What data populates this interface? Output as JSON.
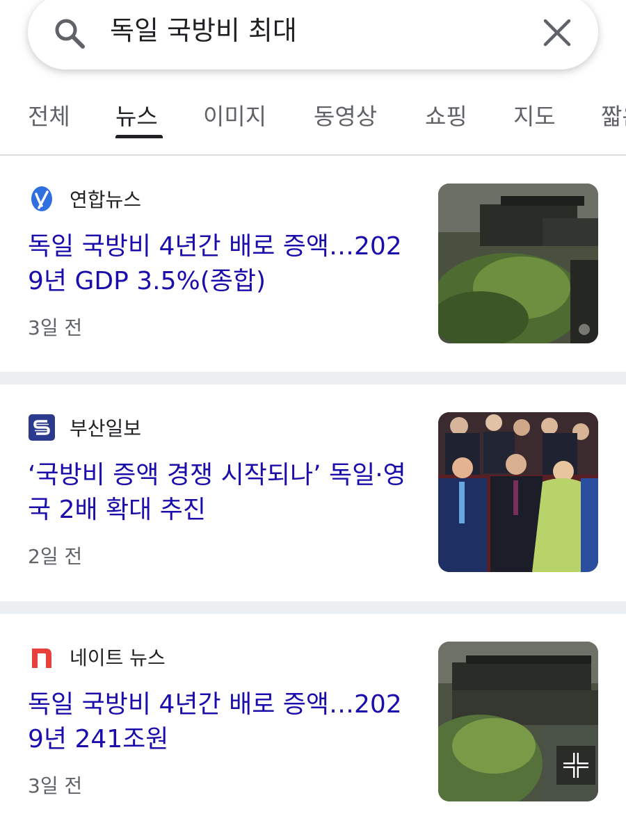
{
  "search": {
    "query": "독일 국방비 최대",
    "search_icon": "search-icon",
    "clear_icon": "close-icon"
  },
  "tabs": [
    {
      "label": "전체",
      "active": false
    },
    {
      "label": "뉴스",
      "active": true
    },
    {
      "label": "이미지",
      "active": false
    },
    {
      "label": "동영상",
      "active": false
    },
    {
      "label": "쇼핑",
      "active": false
    },
    {
      "label": "지도",
      "active": false
    },
    {
      "label": "짧은",
      "active": false
    }
  ],
  "results": [
    {
      "source": "연합뉴스",
      "logo_icon": "yonhap-logo-icon",
      "headline": "독일 국방비 4년간 배로 증액…2029년 GDP 3.5%(종합)",
      "time": "3일 전",
      "thumbnail": "military-vehicle-image"
    },
    {
      "source": "부산일보",
      "logo_icon": "busan-ilbo-logo-icon",
      "headline": "‘국방비 증액 경쟁 시작되나’ 독일·영국 2배 확대 추진",
      "time": "2일 전",
      "thumbnail": "leaders-group-photo-image"
    },
    {
      "source": "네이트 뉴스",
      "logo_icon": "nate-logo-icon",
      "headline": "독일 국방비 4년간 배로 증액…2029년 241조원",
      "time": "3일 전",
      "thumbnail": "military-vehicle-image"
    }
  ],
  "colors": {
    "link": "#1a0dab",
    "text": "#202124",
    "muted": "#5f6368",
    "separator": "#eceff1",
    "yonhap_blue": "#2f6fe0",
    "busan_navy": "#2b3a8c",
    "nate_red": "#e8403a"
  }
}
